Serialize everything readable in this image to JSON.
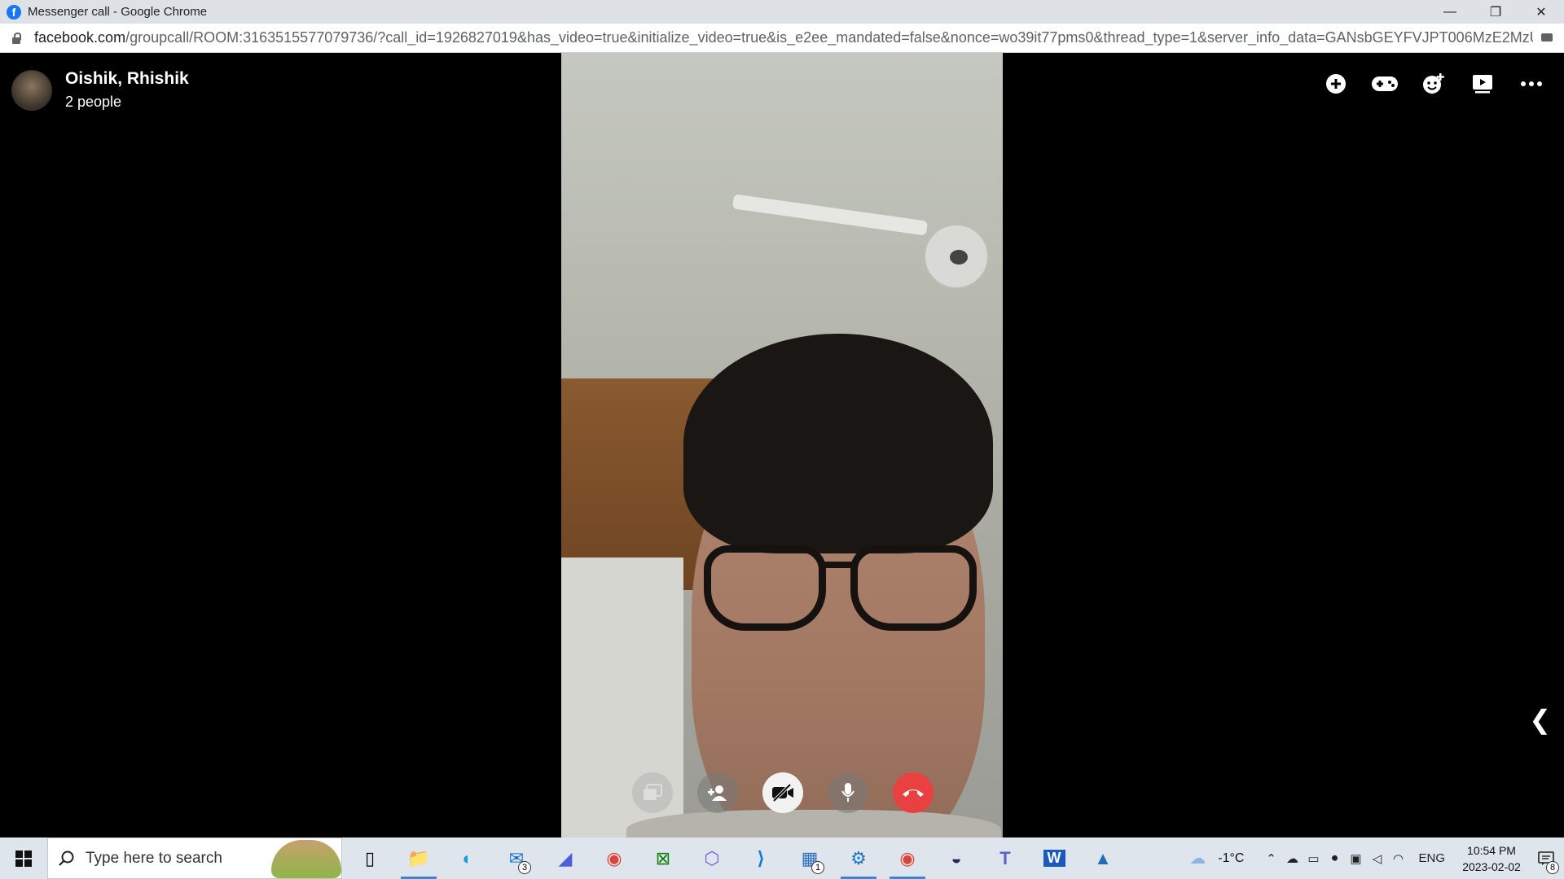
{
  "window": {
    "title": "Messenger call - Google Chrome",
    "minimize_label": "—",
    "restore_label": "❐",
    "close_label": "✕"
  },
  "address": {
    "host": "facebook.com",
    "path": "/groupcall/ROOM:3163515577079736/?call_id=1926827019&has_video=true&initialize_video=true&is_e2ee_mandated=false&nonce=wo39it77pms0&thread_type=1&server_info_data=GANsbGEYFVJPT006MzE2MzUxNTU..."
  },
  "call": {
    "name": "Oishik, Rhishik",
    "people": "2 people",
    "top_actions": [
      "add-icon",
      "games-icon",
      "effects-icon",
      "watch-together-icon",
      "more-icon"
    ],
    "controls": [
      "share-screen-icon",
      "add-person-icon",
      "camera-off-icon",
      "microphone-icon",
      "end-call-icon"
    ],
    "collapse_glyph": "❮"
  },
  "taskbar": {
    "search_placeholder": "Type here to search",
    "apps": [
      {
        "name": "task-view-icon",
        "glyph": "▯"
      },
      {
        "name": "file-explorer-icon",
        "glyph": "📁",
        "active": true
      },
      {
        "name": "edge-icon",
        "glyph": "◐"
      },
      {
        "name": "mail-icon",
        "glyph": "✉",
        "badge": "3"
      },
      {
        "name": "pen-app-icon",
        "glyph": "◢"
      },
      {
        "name": "chrome-icon",
        "glyph": "◉"
      },
      {
        "name": "xbox-icon",
        "glyph": "⊠"
      },
      {
        "name": "copilot-icon",
        "glyph": "⬡"
      },
      {
        "name": "vscode-icon",
        "glyph": "⟩"
      },
      {
        "name": "store-icon",
        "glyph": "▦",
        "badge": "1"
      },
      {
        "name": "settings-app-icon",
        "glyph": "⚙",
        "active": true
      },
      {
        "name": "chrome-active-icon",
        "glyph": "◉",
        "active": true
      },
      {
        "name": "eclipse-icon",
        "glyph": "◒"
      },
      {
        "name": "teams-icon",
        "glyph": "T"
      },
      {
        "name": "word-icon",
        "glyph": "W"
      },
      {
        "name": "photos-icon",
        "glyph": "▲"
      }
    ],
    "temperature": "-1°C",
    "language": "ENG",
    "time": "10:54 PM",
    "date": "2023-02-02",
    "notification_count": "8"
  },
  "colors": {
    "end_call": "#e94141",
    "fb_blue": "#1877f2",
    "taskbar_accent": "#3a86d6"
  }
}
